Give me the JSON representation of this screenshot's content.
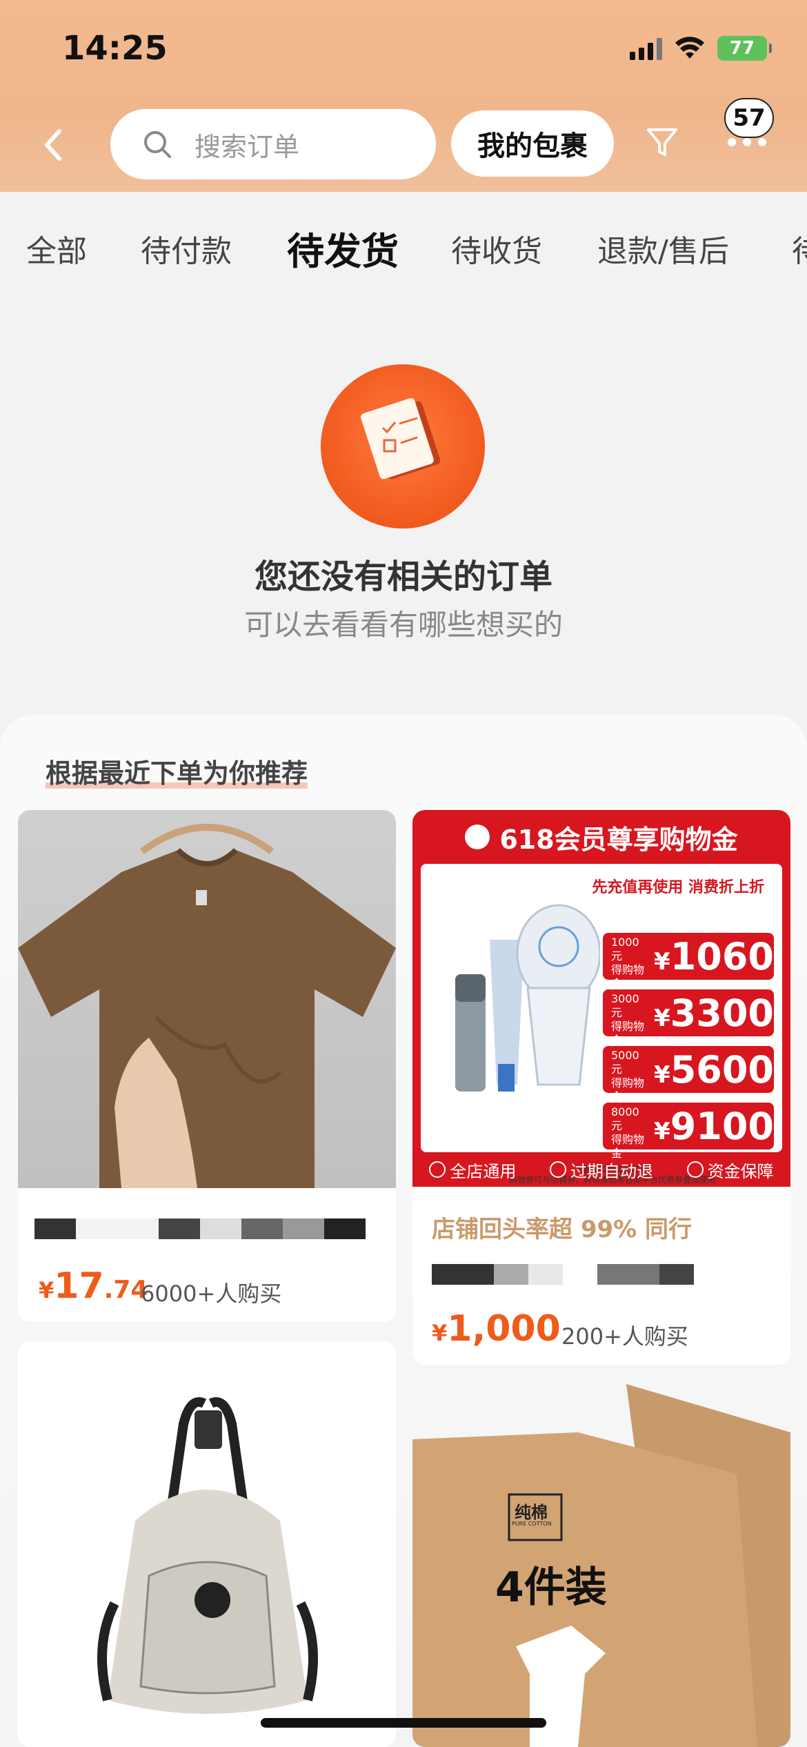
{
  "status_bar": {
    "time": "14:25",
    "battery": "77"
  },
  "header": {
    "search_placeholder": "搜索订单",
    "packages_label": "我的包裹",
    "message_badge": "57"
  },
  "tabs": [
    "全部",
    "待付款",
    "待发货",
    "待收货",
    "退款/售后",
    "待"
  ],
  "active_tab": "待发货",
  "empty_state": {
    "title": "您还没有相关的订单",
    "subtitle": "可以去看看有哪些想买的"
  },
  "recommend": {
    "title": "根据最近下单为你推荐",
    "products": [
      {
        "price_symbol": "¥",
        "price_int": "17",
        "price_dec": ".74",
        "sales": "6000+人购买"
      },
      {
        "store_tag": "店铺回头率超 99% 同行",
        "price_symbol": "¥",
        "price_int": "1,000",
        "sales": "200+人购买"
      }
    ],
    "promo": {
      "headline": "618会员尊享购物金",
      "tagline": "先充值再使用 消费折上折",
      "tiers": [
        {
          "recharge": "充1000元",
          "get": "得购物金",
          "amount": "1060"
        },
        {
          "recharge": "充3000元",
          "get": "得购物金",
          "amount": "3300"
        },
        {
          "recharge": "充5000元",
          "get": "得购物金",
          "amount": "5600"
        },
        {
          "recharge": "充8000元",
          "get": "得购物金",
          "amount": "9100"
        }
      ],
      "note_line1": "*全店实物商品可用",
      "note_line2": "购物券可与店铺券，购物津贴等各类平台优惠券叠加使用",
      "features": [
        "全店通用",
        "过期自动退",
        "资金保障"
      ]
    },
    "kraft": {
      "label_top": "纯棉",
      "label_sub": "PURE COTTON",
      "count": "4件装"
    }
  },
  "colors": {
    "accent": "#f05a1a",
    "header": "#f3b98f",
    "promo_red": "#d7161f"
  }
}
